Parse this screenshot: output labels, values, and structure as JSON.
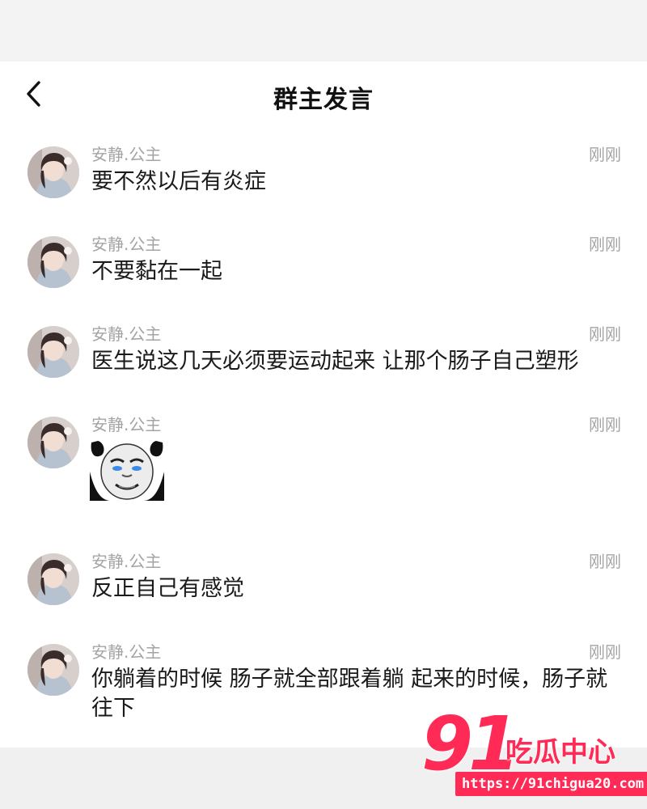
{
  "header": {
    "title": "群主发言",
    "back_icon": "chevron-left-icon"
  },
  "messages": [
    {
      "sender": "安静.公主",
      "time": "刚刚",
      "text": "要不然以后有炎症"
    },
    {
      "sender": "安静.公主",
      "time": "刚刚",
      "text": "不要黏在一起"
    },
    {
      "sender": "安静.公主",
      "time": "刚刚",
      "text": "医生说这几天必须要运动起来 让那个肠子自己塑形"
    },
    {
      "sender": "安静.公主",
      "time": "刚刚",
      "sticker": "panda-face-sticker"
    },
    {
      "sender": "安静.公主",
      "time": "刚刚",
      "text": "反正自己有感觉"
    },
    {
      "sender": "安静.公主",
      "time": "刚刚",
      "text": "你躺着的时候 肠子就全部跟着躺 起来的时候，肠子就往下"
    }
  ],
  "watermark": {
    "number": "91",
    "brand": "吃瓜中心",
    "url": "https://91chigua20.com"
  },
  "colors": {
    "meta_text": "#a4a4a4",
    "body_text": "#1a1a1a",
    "watermark": "#ff2a55"
  }
}
